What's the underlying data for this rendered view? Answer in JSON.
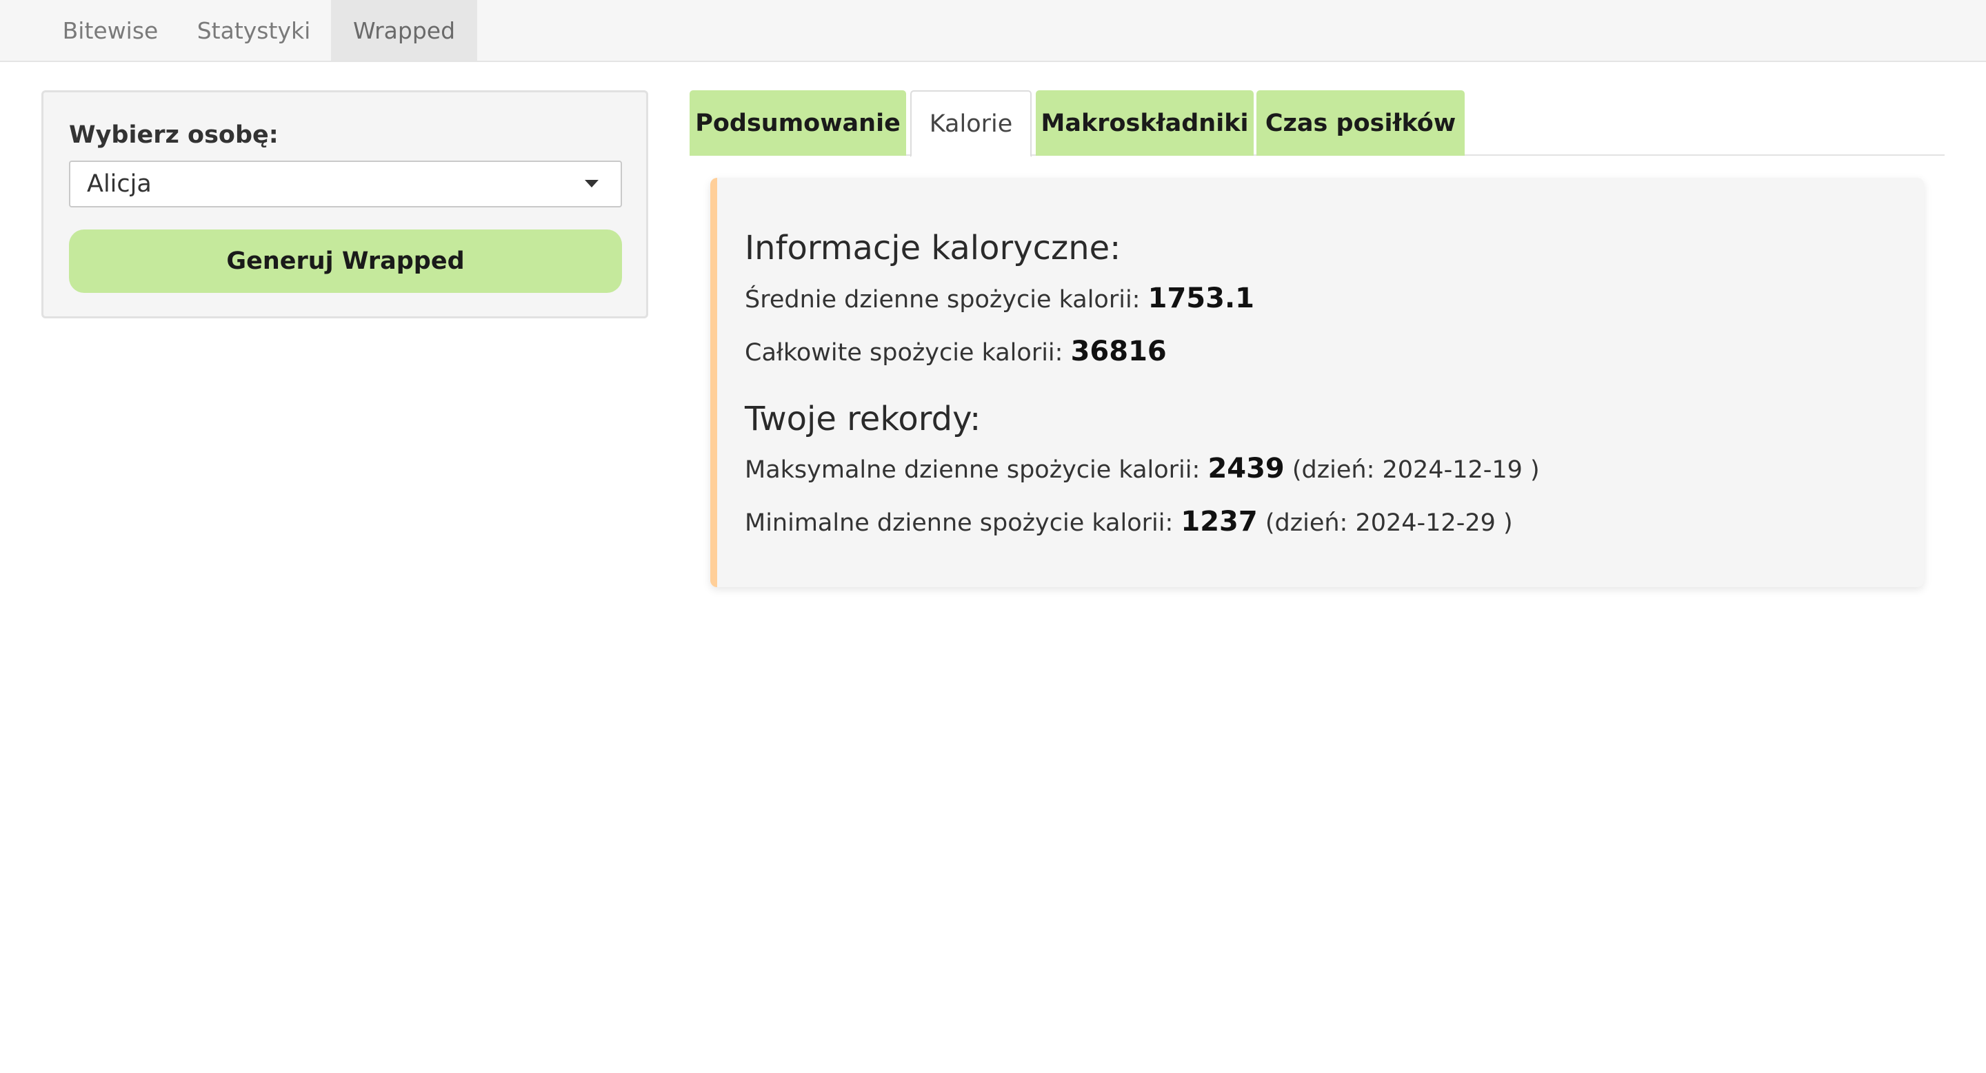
{
  "nav": {
    "items": [
      {
        "label": "Bitewise"
      },
      {
        "label": "Statystyki"
      },
      {
        "label": "Wrapped"
      }
    ],
    "active": "Wrapped"
  },
  "sidebar": {
    "select_label": "Wybierz osobę:",
    "selected_person": "Alicja",
    "generate_label": "Generuj Wrapped"
  },
  "tabs": {
    "items": [
      {
        "label": "Podsumowanie"
      },
      {
        "label": "Kalorie"
      },
      {
        "label": "Makroskładniki"
      },
      {
        "label": "Czas posiłków"
      }
    ],
    "active": "Kalorie"
  },
  "calories": {
    "info_heading": "Informacje kaloryczne:",
    "avg_label": "Średnie dzienne spożycie kalorii:",
    "avg_value": "1753.1",
    "total_label": "Całkowite spożycie kalorii:",
    "total_value": "36816",
    "records_heading": "Twoje rekordy:",
    "max_label": "Maksymalne dzienne spożycie kalorii:",
    "max_value": "2439",
    "max_day": "(dzień: 2024-12-19 )",
    "min_label": "Minimalne dzienne spożycie kalorii:",
    "min_value": "1237",
    "min_day": "(dzień: 2024-12-29 )"
  },
  "colors": {
    "accent_green": "#c5e99c",
    "card_border": "#ffcf99",
    "panel_bg": "#f5f5f5"
  }
}
